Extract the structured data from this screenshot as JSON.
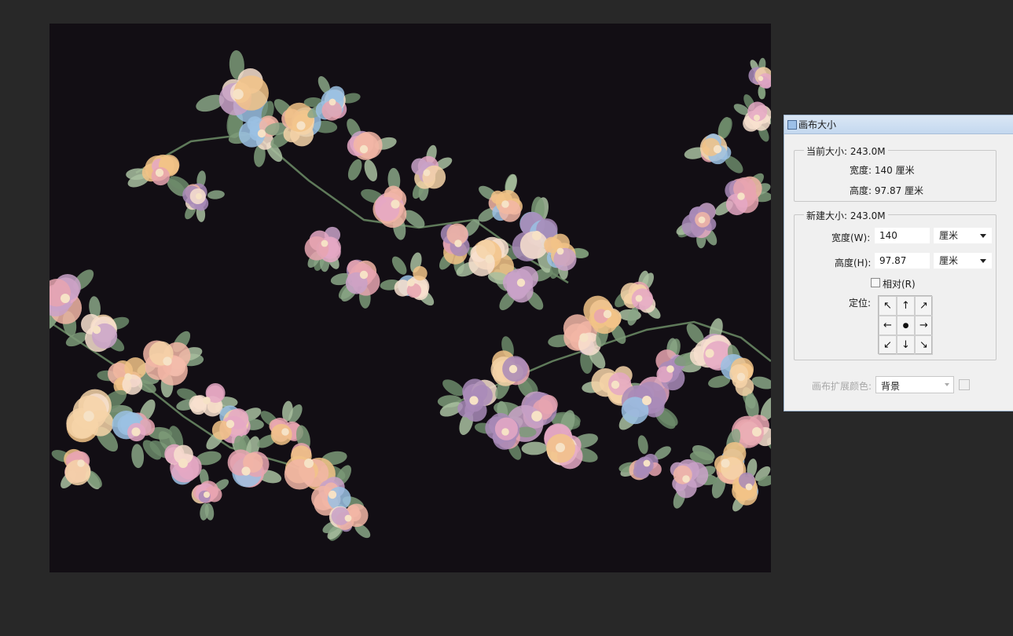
{
  "colors": {
    "workspace": "#282828",
    "canvas_bg": "#120e14",
    "dialog_bg": "#f0f0f0",
    "titlebar": "#c4d8ef"
  },
  "dialog": {
    "title": "画布大小",
    "current_size": {
      "label": "当前大小: 243.0M",
      "width_text": "宽度:  140 厘米",
      "height_text": "高度:  97.87 厘米"
    },
    "new_size": {
      "label": "新建大小: 243.0M",
      "width_label": "宽度(W):",
      "width_value": "140",
      "width_unit": "厘米",
      "height_label": "高度(H):",
      "height_value": "97.87",
      "height_unit": "厘米",
      "relative_label": "相对(R)",
      "relative_checked": false,
      "anchor_label": "定位:"
    },
    "extension_color": {
      "label": "画布扩展颜色:",
      "value": "背景"
    }
  },
  "anchor_arrows": [
    "↖",
    "↑",
    "↗",
    "←",
    "●",
    "→",
    "↙",
    "↓",
    "↘"
  ]
}
